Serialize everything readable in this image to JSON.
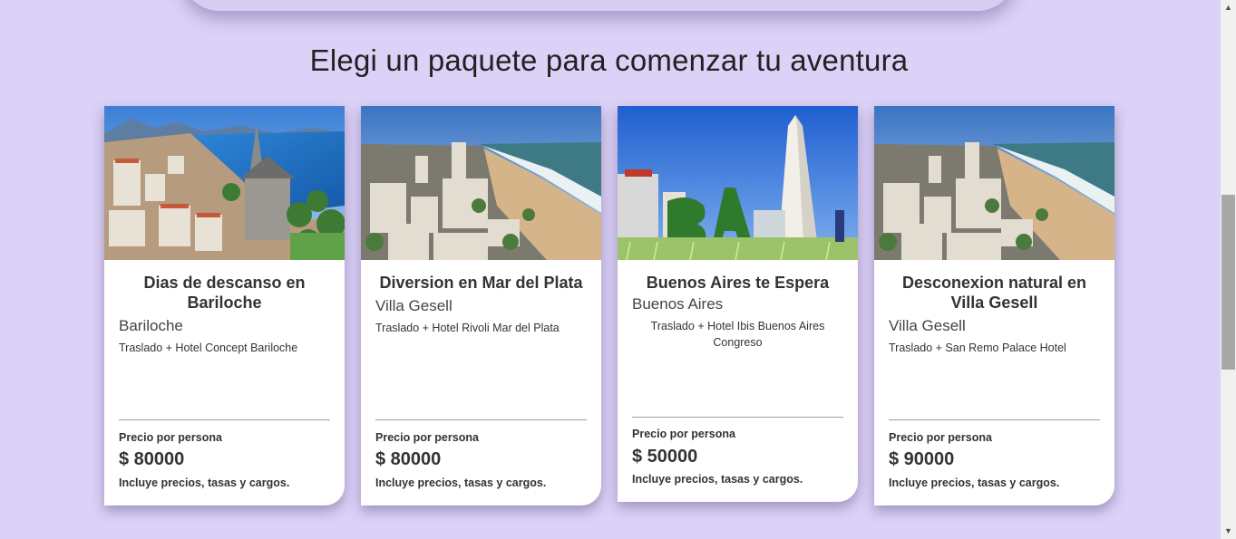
{
  "section": {
    "title": "Elegi un paquete para comenzar tu aventura"
  },
  "cards": [
    {
      "title": "Dias de descanso en Bariloche",
      "city": "Bariloche",
      "description": "Traslado + Hotel Concept Bariloche",
      "price_label": "Precio por persona",
      "price": "$ 80000",
      "note": "Incluye precios, tasas y cargos.",
      "image": "bariloche-cathedral-lake-photo"
    },
    {
      "title": "Diversion en Mar del Plata",
      "city": "Villa Gesell",
      "description": "Traslado + Hotel Rivoli Mar del Plata",
      "price_label": "Precio por persona",
      "price": "$ 80000",
      "note": "Incluye precios, tasas y cargos.",
      "image": "beach-city-coast-photo"
    },
    {
      "title": "Buenos Aires te Espera",
      "city": "Buenos Aires",
      "description": "Traslado + Hotel Ibis Buenos Aires Congreso",
      "price_label": "Precio por persona",
      "price": "$ 50000",
      "note": "Incluye precios, tasas y cargos.",
      "image": "obelisco-ba-letters-photo"
    },
    {
      "title": "Desconexion natural en Villa Gesell",
      "city": "Villa Gesell",
      "description": "Traslado + San Remo Palace Hotel",
      "price_label": "Precio por persona",
      "price": "$ 90000",
      "note": "Incluye precios, tasas y cargos.",
      "image": "beach-city-coast-photo"
    }
  ],
  "scrollbar": {
    "up_icon": "triangle-up-icon",
    "down_icon": "triangle-down-icon"
  },
  "colors": {
    "background": "#dcd1f7",
    "card": "#ffffff",
    "text": "#333333"
  }
}
